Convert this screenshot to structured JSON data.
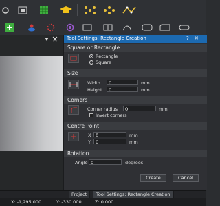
{
  "panel": {
    "title": "Tool Settings: Rectangle Creation",
    "title_controls": [
      "?",
      "✕"
    ],
    "sections": {
      "shape": {
        "heading": "Square or Rectangle",
        "options": [
          "Rectangle",
          "Square"
        ],
        "selected": "Rectangle"
      },
      "size": {
        "heading": "Size",
        "width_label": "Width",
        "width_value": "0",
        "width_unit": "mm",
        "height_label": "Height",
        "height_value": "0",
        "height_unit": "mm"
      },
      "corners": {
        "heading": "Corners",
        "radius_label": "Corner radius",
        "radius_value": "0",
        "radius_unit": "mm",
        "invert_label": "Invert corners"
      },
      "centre": {
        "heading": "Centre Point",
        "x_label": "X",
        "x_value": "0",
        "x_unit": "mm",
        "y_label": "Y",
        "y_value": "0",
        "y_unit": "mm"
      },
      "rotation": {
        "heading": "Rotation",
        "angle_label": "Angle",
        "angle_value": "0",
        "angle_unit": "degrees"
      }
    },
    "buttons": {
      "create": "Create",
      "cancel": "Cancel"
    }
  },
  "tabs": [
    "Project",
    "Tool Settings: Rectangle Creation"
  ],
  "active_tab": "Tool Settings: Rectangle Creation",
  "status": {
    "x": "X: -1,295.000",
    "y": "Y: -330.000",
    "z": "Z: 0.000"
  },
  "colors": {
    "title_bar": "#1c6ab1",
    "icon_green": "#3fae3f",
    "icon_yellow": "#f2c21a",
    "icon_purple": "#9b59d0",
    "icon_red": "#d23a3a"
  }
}
